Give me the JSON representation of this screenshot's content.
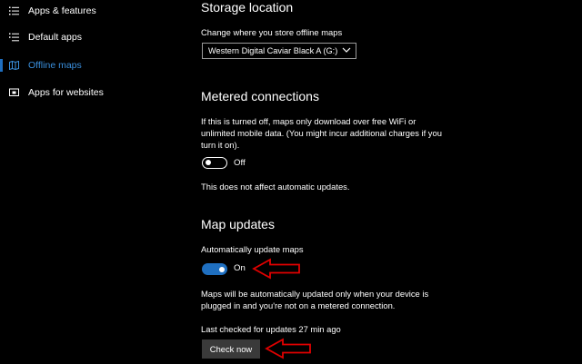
{
  "sidebar": {
    "items": [
      {
        "label": "Apps & features",
        "icon": "apps-features-icon"
      },
      {
        "label": "Default apps",
        "icon": "default-apps-icon"
      },
      {
        "label": "Offline maps",
        "icon": "offline-maps-icon",
        "active": true
      },
      {
        "label": "Apps for websites",
        "icon": "apps-for-websites-icon"
      }
    ],
    "accent_color": "#1f6fc0"
  },
  "storage": {
    "heading": "Storage location",
    "description": "Change where you store offline maps",
    "dropdown_value": "Western Digital Caviar Black A (G:)"
  },
  "metered": {
    "heading": "Metered connections",
    "description_line1": "If this is turned off, maps only download over free WiFi or",
    "description_line2": "unlimited mobile data. (You might incur additional charges if you",
    "description_line3": "turn it on).",
    "toggle_label": "Off",
    "toggle_state": false,
    "note": "This does not affect automatic updates."
  },
  "map_updates": {
    "heading": "Map updates",
    "auto_update_label": "Automatically update maps",
    "toggle_label": "On",
    "toggle_state": true,
    "description_line1": "Maps will be automatically updated only when your device is",
    "description_line2": "plugged in and you're not on a metered connection.",
    "last_checked": "Last checked for updates 27 min ago",
    "check_button": "Check now"
  },
  "colors": {
    "background": "#000000",
    "toggle_on": "#1f6fc0",
    "button_bg": "#3a3a3a",
    "annotation_arrow": "#e00000"
  }
}
